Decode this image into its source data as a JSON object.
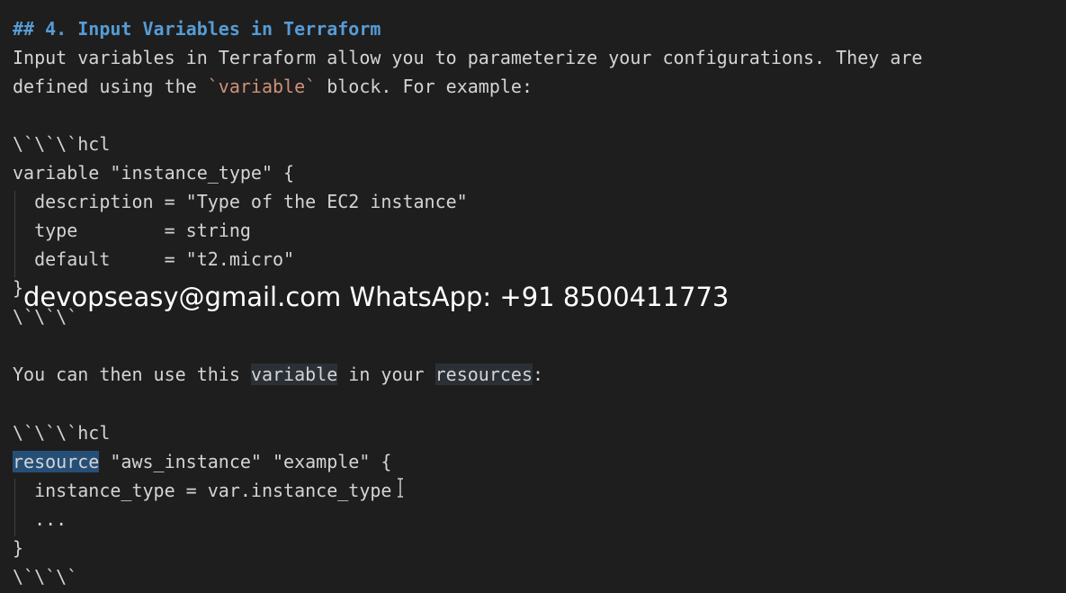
{
  "editor": {
    "lines": {
      "heading": "## 4. Input Variables in Terraform",
      "para1": "Input variables in Terraform allow you to parameterize your configurations. They are",
      "para2_before": "defined using the ",
      "para2_code": "`variable`",
      "para2_after": " block. For example:",
      "fence1": "\\`\\`\\`hcl",
      "var_open": "variable \"instance_type\" {",
      "desc": "  description = \"Type of the EC2 instance\"",
      "type": "  type        = string",
      "default": "  default     = \"t2.micro\"",
      "close1": "}",
      "fence2": "\\`\\`\\`",
      "para3_a": "You can then use this ",
      "para3_b": "variable",
      "para3_c": " in your ",
      "para3_d": "resources",
      "para3_e": ":",
      "fence3": "\\`\\`\\`hcl",
      "res_kw": "resource",
      "res_rest": " \"aws_instance\" \"example\" {",
      "inst": "  instance_type = var.instance_type",
      "ellipsis": "  ...",
      "close2": "}",
      "fence4": "\\`\\`\\`"
    },
    "watermark": "devopseasy@gmail.com WhatsApp: +91 8500411773"
  },
  "colors": {
    "background": "#1e1e1e",
    "text": "#d4d4d4",
    "heading": "#569cd6",
    "inline_code": "#ce9178",
    "selection": "#264f78"
  },
  "icons": {
    "cursor": "text-cursor-icon"
  }
}
